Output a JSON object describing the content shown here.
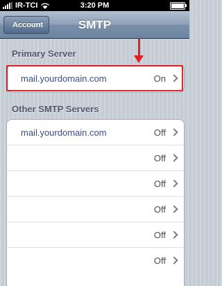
{
  "status_bar": {
    "carrier": "IR-TCI",
    "time": "3:20 PM"
  },
  "nav": {
    "back_label": "Account",
    "title": "SMTP"
  },
  "primary": {
    "header": "Primary Server",
    "row": {
      "host": "mail.yourdomain.com",
      "status": "On"
    }
  },
  "other": {
    "header": "Other SMTP Servers",
    "rows": [
      {
        "host": "mail.yourdomain.com",
        "status": "Off"
      },
      {
        "host": "",
        "status": "Off"
      },
      {
        "host": "",
        "status": "Off"
      },
      {
        "host": "",
        "status": "Off"
      },
      {
        "host": "",
        "status": "Off"
      },
      {
        "host": "",
        "status": "Off"
      }
    ]
  },
  "colors": {
    "highlight": "#e01e26",
    "link_text": "#394f8c",
    "section_text": "#4c566c"
  }
}
